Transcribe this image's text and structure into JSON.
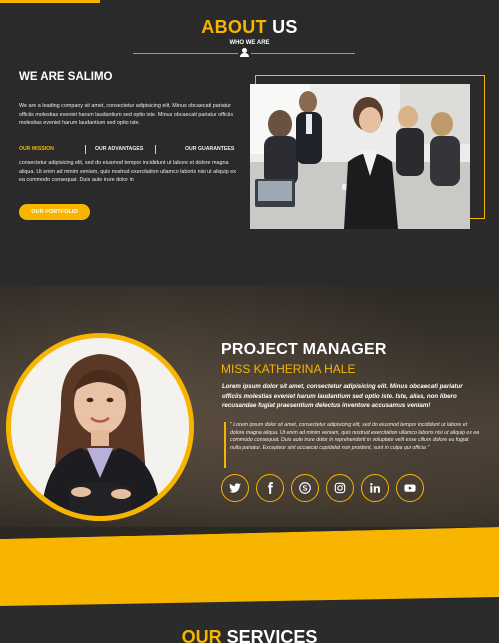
{
  "about": {
    "title_hl": "ABOUT",
    "title_rest": " US",
    "subtitle": "WHO WE ARE",
    "heading_prefix": "WE ARE ",
    "heading_bold": "SALIMO",
    "description": "We are a leading company sit amet, consectetur adipisicing elit. Minus obcaecati pariatur officiis molestias eveniet harum laudantium sed optio iste. Minus obcaecati pariatur officiis molestias eveniet harum laudantium sed optio iste.",
    "tabs": [
      "OUR MISSION",
      "OUR ADVANTAGES",
      "OUR GUARANTEES"
    ],
    "tab_text": "consectetur adipisicing elit, sed do eiusmod tempor incididunt ut labore et dolore magna aliqua. Ut enim ad minim veniam, quis nostrud exercitation ullamco laboris nisi ut aliquip ex ea commodo consequat. Duis aute irure dolor in",
    "button": "OUR PORTFOLIO"
  },
  "manager": {
    "title": "PROJECT MANAGER",
    "name": "MISS KATHERINA HALE",
    "intro": "Lorem ipsum dolor sit amet, consectetur adipisicing elit. Minus obcaecati pariatur officiis molestias eveniet harum laudantium sed optio iste. Iste, alias, non libero recusandae fugiat praesentium delectus inventore accusamus veniam!",
    "quote": "\" Lorem ipsum dolor sit amet, consectetur adipisicing elit, sed do eiusmod tempor incididunt ut labore et dolore magna aliqua. Ut enim ad minim veniam, quis nostrud exercitation ullamco laboris nisi ut aliquip ex ea commodo consequat. Duis aute irure dolor in reprehenderit in voluptate velit esse cillum dolore eu fugiat nulla pariatur. Excepteur sint occaecat cupidatat non proident, sunt in culpa qui officia \"",
    "socials": [
      "twitter-icon",
      "facebook-icon",
      "skype-icon",
      "instagram-icon",
      "linkedin-icon",
      "youtube-icon"
    ]
  },
  "services": {
    "title_hl": "OUR",
    "title_rest": " SERVICES"
  },
  "colors": {
    "accent": "#f7b500",
    "background": "#2a2a2a"
  }
}
